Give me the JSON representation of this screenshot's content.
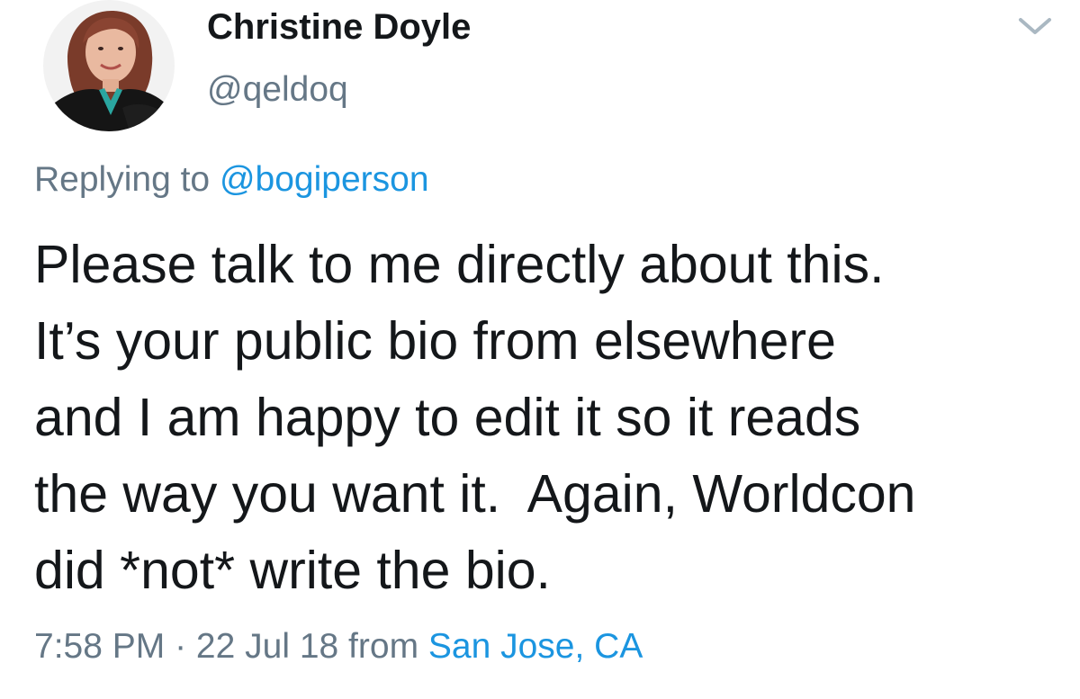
{
  "author": {
    "display_name": "Christine Doyle",
    "handle": "@qeldoq",
    "avatar_icon": "profile-photo"
  },
  "menu": {
    "caret_icon": "chevron-down-icon"
  },
  "reply": {
    "prefix": "Replying to ",
    "target": "@bogiperson"
  },
  "tweet": {
    "lines": [
      "Please talk to me directly about this.",
      "It’s your public bio from elsewhere",
      "and I am happy to edit it so it reads",
      "the way you want it.  Again, Worldcon",
      "did *not* write the bio."
    ]
  },
  "meta": {
    "time": "7:58 PM",
    "separator": " · ",
    "date": "22 Jul 18",
    "from_label": " from ",
    "location": "San Jose, CA"
  },
  "colors": {
    "text": "#14171a",
    "secondary": "#657786",
    "link": "#1b95e0",
    "caret": "#aab8c2"
  }
}
